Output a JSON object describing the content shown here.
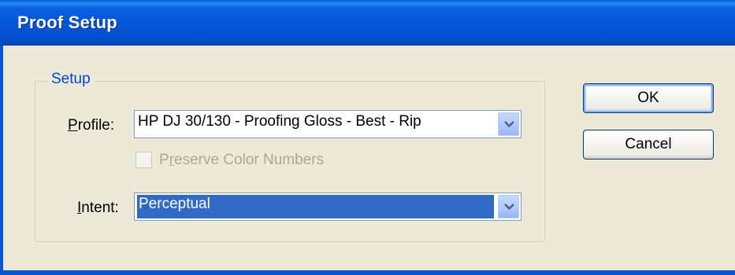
{
  "window": {
    "title": "Proof Setup"
  },
  "setup_group": {
    "label": "Setup"
  },
  "profile": {
    "label_prefix": "",
    "label_mnemonic": "P",
    "label_rest": "rofile:",
    "value": "HP DJ 30/130 - Proofing Gloss - Best - Rip"
  },
  "preserve": {
    "label_prefix": "P",
    "label_mnemonic": "r",
    "label_rest": "eserve Color Numbers",
    "checked": false,
    "enabled": false
  },
  "intent": {
    "label_mnemonic": "I",
    "label_rest": "ntent:",
    "value": "Perceptual"
  },
  "buttons": {
    "ok": "OK",
    "cancel": "Cancel"
  },
  "icons": {
    "dropdown": "chevron-down-icon"
  }
}
